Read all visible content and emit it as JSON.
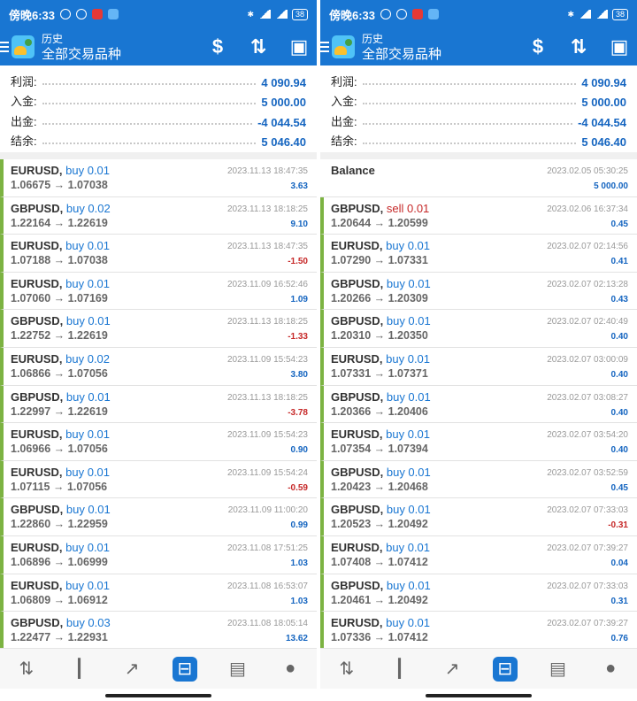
{
  "colors": {
    "brand": "#1976d2",
    "profit_positive": "#1565c0",
    "profit_negative": "#c62828",
    "accent_bar": "#7cb342"
  },
  "status_bar": {
    "time": "傍晚6:33",
    "battery": "38"
  },
  "app": {
    "title": "历史",
    "subtitle": "全部交易品种"
  },
  "actions": [
    {
      "name": "dollar-sort-icon",
      "glyph": "$"
    },
    {
      "name": "sort-icon",
      "glyph": "⇅"
    },
    {
      "name": "calendar-icon",
      "glyph": "▣"
    }
  ],
  "summary_labels": {
    "profit": "利润:",
    "deposit": "入金:",
    "withdrawal": "出金:",
    "balance": "结余:"
  },
  "left": {
    "summary": {
      "profit": "4 090.94",
      "deposit": "5 000.00",
      "withdrawal": "-4 044.54",
      "balance": "5 046.40"
    },
    "trades": [
      {
        "symbol": "EURUSD,",
        "side": "buy 0.01",
        "prices": "1.06675 → 1.07038",
        "time": "2023.11.13 18:47:35",
        "profit": "3.63",
        "neg": false
      },
      {
        "symbol": "GBPUSD,",
        "side": "buy 0.02",
        "prices": "1.22164 → 1.22619",
        "time": "2023.11.13 18:18:25",
        "profit": "9.10",
        "neg": false
      },
      {
        "symbol": "EURUSD,",
        "side": "buy 0.01",
        "prices": "1.07188 → 1.07038",
        "time": "2023.11.13 18:47:35",
        "profit": "-1.50",
        "neg": true
      },
      {
        "symbol": "EURUSD,",
        "side": "buy 0.01",
        "prices": "1.07060 → 1.07169",
        "time": "2023.11.09 16:52:46",
        "profit": "1.09",
        "neg": false
      },
      {
        "symbol": "GBPUSD,",
        "side": "buy 0.01",
        "prices": "1.22752 → 1.22619",
        "time": "2023.11.13 18:18:25",
        "profit": "-1.33",
        "neg": true
      },
      {
        "symbol": "EURUSD,",
        "side": "buy 0.02",
        "prices": "1.06866 → 1.07056",
        "time": "2023.11.09 15:54:23",
        "profit": "3.80",
        "neg": false
      },
      {
        "symbol": "GBPUSD,",
        "side": "buy 0.01",
        "prices": "1.22997 → 1.22619",
        "time": "2023.11.13 18:18:25",
        "profit": "-3.78",
        "neg": true
      },
      {
        "symbol": "EURUSD,",
        "side": "buy 0.01",
        "prices": "1.06966 → 1.07056",
        "time": "2023.11.09 15:54:23",
        "profit": "0.90",
        "neg": false
      },
      {
        "symbol": "EURUSD,",
        "side": "buy 0.01",
        "prices": "1.07115 → 1.07056",
        "time": "2023.11.09 15:54:24",
        "profit": "-0.59",
        "neg": true
      },
      {
        "symbol": "GBPUSD,",
        "side": "buy 0.01",
        "prices": "1.22860 → 1.22959",
        "time": "2023.11.09 11:00:20",
        "profit": "0.99",
        "neg": false
      },
      {
        "symbol": "EURUSD,",
        "side": "buy 0.01",
        "prices": "1.06896 → 1.06999",
        "time": "2023.11.08 17:51:25",
        "profit": "1.03",
        "neg": false
      },
      {
        "symbol": "EURUSD,",
        "side": "buy 0.01",
        "prices": "1.06809 → 1.06912",
        "time": "2023.11.08 16:53:07",
        "profit": "1.03",
        "neg": false
      },
      {
        "symbol": "GBPUSD,",
        "side": "buy 0.03",
        "prices": "1.22477 → 1.22931",
        "time": "2023.11.08 18:05:14",
        "profit": "13.62",
        "neg": false
      }
    ]
  },
  "right": {
    "summary": {
      "profit": "4 090.94",
      "deposit": "5 000.00",
      "withdrawal": "-4 044.54",
      "balance": "5 046.40"
    },
    "balance_entry": {
      "label": "Balance",
      "time": "2023.02.05 05:30:25",
      "amount": "5 000.00"
    },
    "trades": [
      {
        "symbol": "GBPUSD,",
        "side": "sell 0.01",
        "prices": "1.20644 → 1.20599",
        "time": "2023.02.06 16:37:34",
        "profit": "0.45",
        "neg": false,
        "sell": true
      },
      {
        "symbol": "EURUSD,",
        "side": "buy 0.01",
        "prices": "1.07290 → 1.07331",
        "time": "2023.02.07 02:14:56",
        "profit": "0.41",
        "neg": false
      },
      {
        "symbol": "GBPUSD,",
        "side": "buy 0.01",
        "prices": "1.20266 → 1.20309",
        "time": "2023.02.07 02:13:28",
        "profit": "0.43",
        "neg": false
      },
      {
        "symbol": "GBPUSD,",
        "side": "buy 0.01",
        "prices": "1.20310 → 1.20350",
        "time": "2023.02.07 02:40:49",
        "profit": "0.40",
        "neg": false
      },
      {
        "symbol": "EURUSD,",
        "side": "buy 0.01",
        "prices": "1.07331 → 1.07371",
        "time": "2023.02.07 03:00:09",
        "profit": "0.40",
        "neg": false
      },
      {
        "symbol": "GBPUSD,",
        "side": "buy 0.01",
        "prices": "1.20366 → 1.20406",
        "time": "2023.02.07 03:08:27",
        "profit": "0.40",
        "neg": false
      },
      {
        "symbol": "EURUSD,",
        "side": "buy 0.01",
        "prices": "1.07354 → 1.07394",
        "time": "2023.02.07 03:54:20",
        "profit": "0.40",
        "neg": false
      },
      {
        "symbol": "GBPUSD,",
        "side": "buy 0.01",
        "prices": "1.20423 → 1.20468",
        "time": "2023.02.07 03:52:59",
        "profit": "0.45",
        "neg": false
      },
      {
        "symbol": "GBPUSD,",
        "side": "buy 0.01",
        "prices": "1.20523 → 1.20492",
        "time": "2023.02.07 07:33:03",
        "profit": "-0.31",
        "neg": true
      },
      {
        "symbol": "EURUSD,",
        "side": "buy 0.01",
        "prices": "1.07408 → 1.07412",
        "time": "2023.02.07 07:39:27",
        "profit": "0.04",
        "neg": false
      },
      {
        "symbol": "GBPUSD,",
        "side": "buy 0.01",
        "prices": "1.20461 → 1.20492",
        "time": "2023.02.07 07:33:03",
        "profit": "0.31",
        "neg": false
      },
      {
        "symbol": "EURUSD,",
        "side": "buy 0.01",
        "prices": "1.07336 → 1.07412",
        "time": "2023.02.07 07:39:27",
        "profit": "0.76",
        "neg": false
      }
    ]
  },
  "bottom_nav": [
    {
      "name": "quotes-nav-icon",
      "glyph": "⇅",
      "active": false
    },
    {
      "name": "chart-nav-icon",
      "glyph": "┃",
      "active": false
    },
    {
      "name": "trade-nav-icon",
      "glyph": "↗",
      "active": false
    },
    {
      "name": "history-nav-icon",
      "glyph": "⊟",
      "active": true
    },
    {
      "name": "news-nav-icon",
      "glyph": "▤",
      "active": false
    },
    {
      "name": "messages-nav-icon",
      "glyph": "●",
      "active": false
    }
  ]
}
